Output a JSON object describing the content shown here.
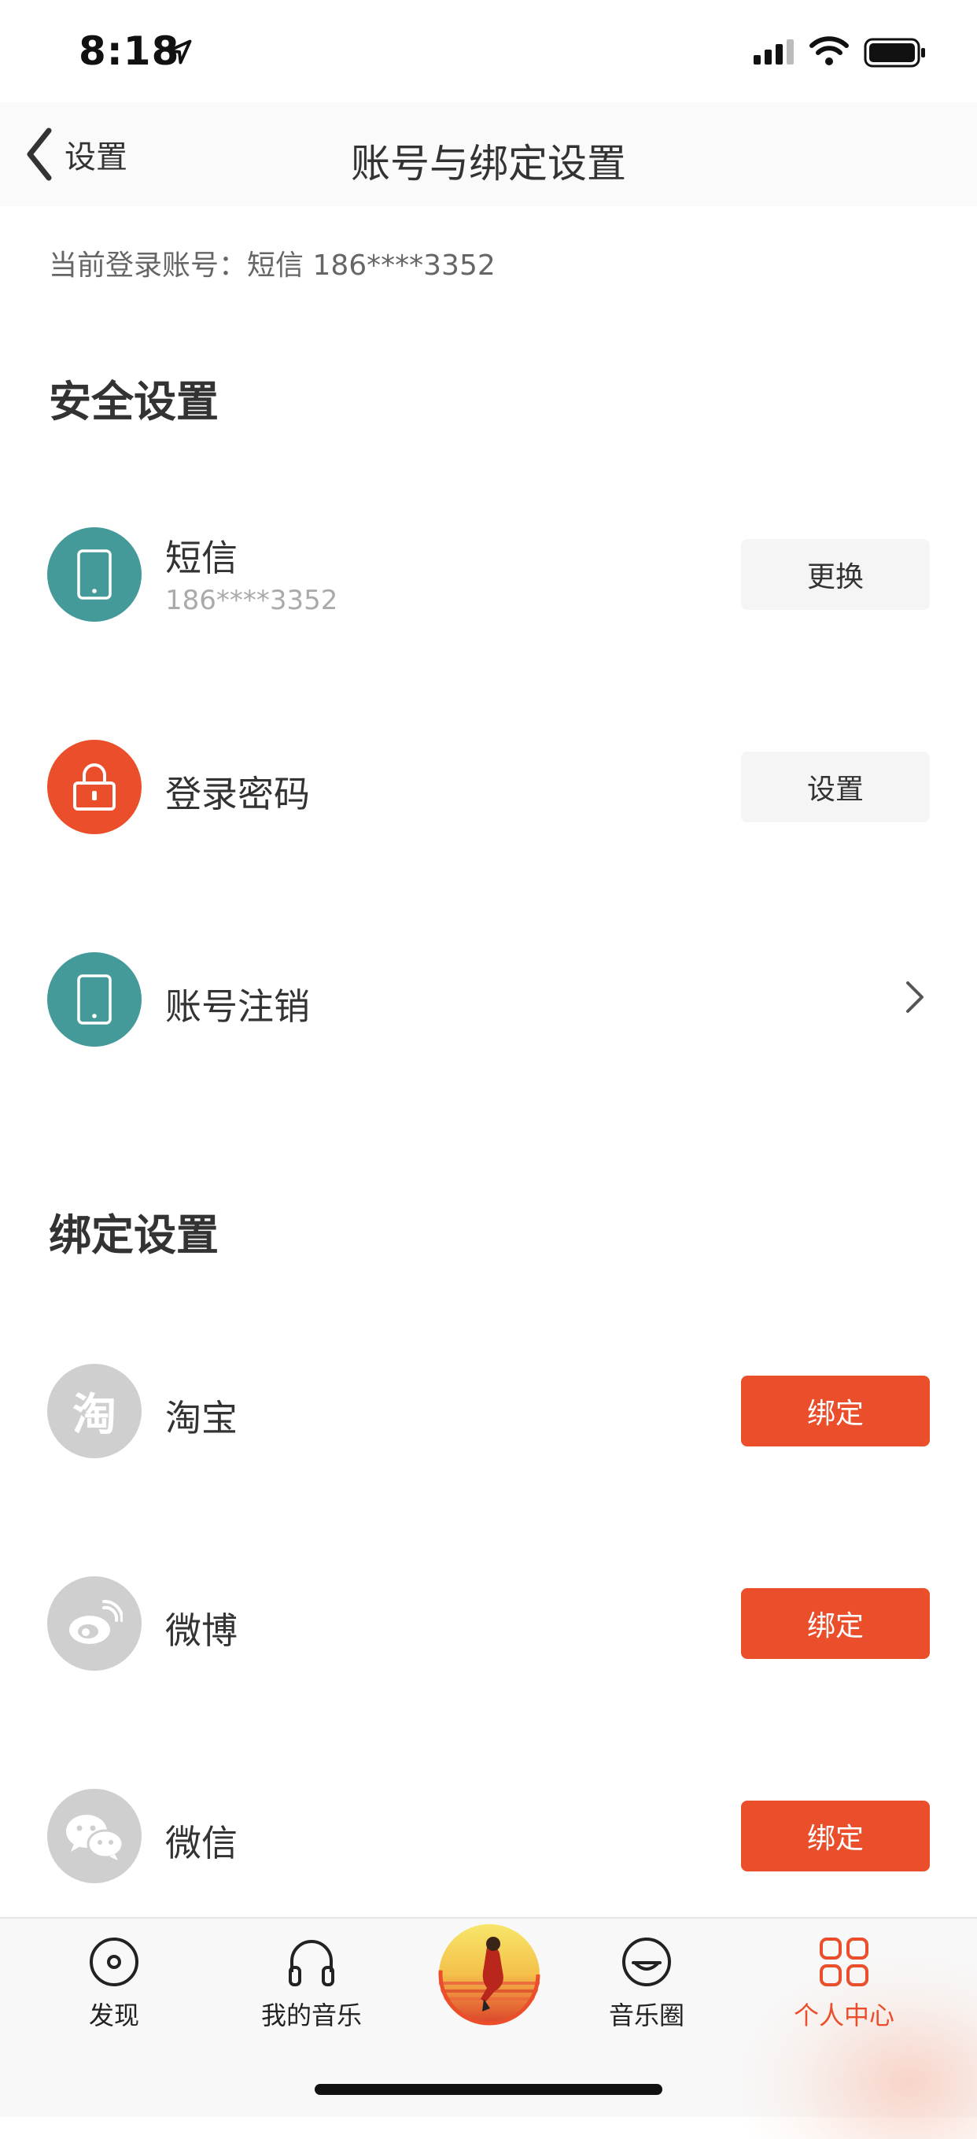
{
  "status_bar": {
    "time": "8:18",
    "icons": [
      "location-arrow-icon",
      "signal-icon",
      "wifi-icon",
      "battery-icon"
    ]
  },
  "nav": {
    "back_label": "设置",
    "title": "账号与绑定设置"
  },
  "current_account": "当前登录账号：短信 186****3352",
  "security": {
    "title": "安全设置",
    "items": [
      {
        "label": "短信",
        "sub": "186****3352",
        "button": "更换",
        "icon": "phone-icon",
        "icon_color": "#449a99"
      },
      {
        "label": "登录密码",
        "button": "设置",
        "icon": "lock-icon",
        "icon_color": "#ea4e2a"
      },
      {
        "label": "账号注销",
        "icon": "phone-icon",
        "icon_color": "#449a99",
        "action_icon": "chevron-right-icon"
      }
    ]
  },
  "binding": {
    "title": "绑定设置",
    "items": [
      {
        "label": "淘宝",
        "button": "绑定",
        "icon": "taobao-icon",
        "icon_glyph": "淘"
      },
      {
        "label": "微博",
        "button": "绑定",
        "icon": "weibo-icon"
      },
      {
        "label": "微信",
        "button": "绑定",
        "icon": "wechat-icon"
      }
    ]
  },
  "tab_bar": {
    "tabs": [
      {
        "label": "发现",
        "icon": "disc-icon"
      },
      {
        "label": "我的音乐",
        "icon": "headphones-icon"
      },
      {
        "label": "音乐圈",
        "icon": "smile-icon"
      },
      {
        "label": "个人中心",
        "icon": "grid-icon",
        "active": true
      }
    ],
    "center": {
      "icon": "album-cover-icon"
    }
  },
  "colors": {
    "accent": "#ea4e2a",
    "teal": "#449a99",
    "grey_icon": "#cfcfcf"
  }
}
